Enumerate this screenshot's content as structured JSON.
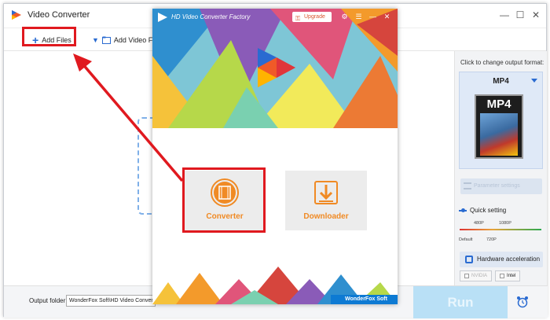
{
  "back_window": {
    "title": "Video Converter",
    "controls": {
      "minimize": "—",
      "maximize": "☐",
      "close": "✕"
    },
    "toolbar": {
      "add_files_label": "Add Files",
      "add_video_folder_label": "Add Video Fol"
    },
    "right_panel": {
      "hint": "Click to change output format:",
      "format_name": "MP4",
      "format_art_label": "MP4",
      "parameter_settings_label": "Parameter settings",
      "quick_setting_label": "Quick setting",
      "ticks": {
        "t480": "480P",
        "t1080": "1080P",
        "tdefault": "Default",
        "t720": "720P"
      },
      "hardware_acceleration_label": "Hardware acceleration",
      "gpu": {
        "nvidia": "NVIDIA",
        "intel": "Intel"
      }
    },
    "bottom": {
      "output_folder_label": "Output folder:",
      "output_folder_value": "WonderFox Soft\\HD Video Converter F",
      "run_label": "Run"
    }
  },
  "front_window": {
    "title": "HD Video Converter Factory",
    "upgrade_label": "Upgrade",
    "modes": {
      "converter": "Converter",
      "downloader": "Downloader"
    },
    "brand": "WonderFox Soft"
  },
  "colors": {
    "accent_blue": "#2a6bd1",
    "highlight_red": "#e0191f",
    "mode_orange": "#f08a24",
    "run_disabled": "#b9e0f6"
  },
  "icons": {
    "app": "video-converter-logo-icon",
    "add": "plus-icon",
    "folder": "folder-icon",
    "converter": "film-strip-icon",
    "downloader": "download-icon",
    "alarm": "alarm-clock-icon"
  }
}
